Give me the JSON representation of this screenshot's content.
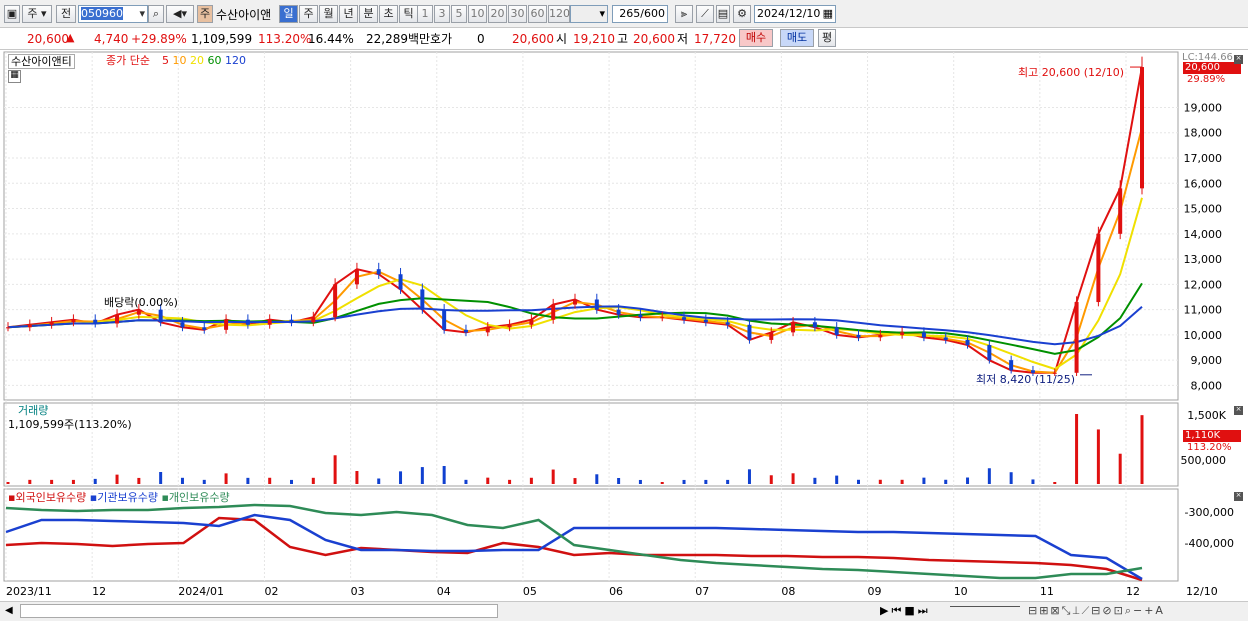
{
  "toolbar": {
    "market_sel": "주",
    "prev_label": "전",
    "code": "050960",
    "name_tag": "주",
    "stock_name": "수산아이앤",
    "periods": [
      "일",
      "주",
      "월",
      "년",
      "분",
      "초",
      "틱"
    ],
    "intervals": [
      "1",
      "3",
      "5",
      "10",
      "20",
      "30",
      "60",
      "120"
    ],
    "count": "265",
    "count_max": "/600",
    "date": "2024/12/10"
  },
  "quote": {
    "price": "20,600",
    "change": "4,740",
    "change_pct": "+29.89%",
    "volume": "1,109,599",
    "vol_ratio": "113.20%",
    "turnover": "16.44%",
    "amount": "22,289백만",
    "hoga_label": "호가",
    "hoga_value": "0",
    "hoga_price": "20,600",
    "open_label": "시",
    "open": "19,210",
    "high_label": "고",
    "high": "20,600",
    "low_label": "저",
    "low": "17,720",
    "buy_btn": "매수",
    "sell_btn": "매도",
    "eval_btn": "평"
  },
  "price_panel": {
    "legend_name": "수산아이앤티",
    "legend_ma": "종가 단순",
    "ma_periods": [
      "5",
      "10",
      "20",
      "60",
      "120"
    ],
    "ma_colors": [
      "#e01010",
      "#ff9a00",
      "#f0e000",
      "#009000",
      "#1a40d0"
    ],
    "corner_label": "LC:144.66",
    "high_annot": "최고 20,600 (12/10)",
    "low_annot": "최저 8,420 (11/25)",
    "dividend_annot": "배당락(0.00%)",
    "last_price_tag": "20,600",
    "last_pct_tag": "29.89%",
    "y_ticks": [
      "19,000",
      "18,000",
      "17,000",
      "16,000",
      "15,000",
      "14,000",
      "13,000",
      "12,000",
      "11,000",
      "10,000",
      "9,000",
      "8,000"
    ]
  },
  "volume_panel": {
    "title": "거래량",
    "info": "1,109,599주(113.20%)",
    "y_ticks": [
      "1,500K",
      "500,000"
    ],
    "last_tag": "1,110K",
    "last_pct": "113.20%"
  },
  "holding_panel": {
    "series": [
      "외국인보유수량",
      "기관보유수량",
      "개인보유수량"
    ],
    "colors": [
      "#d01010",
      "#1a40d0",
      "#2e8b57"
    ],
    "y_ticks": [
      "-300,000",
      "-400,000"
    ]
  },
  "x_axis": {
    "labels": [
      "2023/11",
      "12",
      "2024/01",
      "02",
      "03",
      "04",
      "05",
      "06",
      "07",
      "08",
      "09",
      "10",
      "11",
      "12",
      "12/10"
    ]
  },
  "chart_data": {
    "type": "candlestick",
    "period": "2023/11 - 2024/12/10",
    "price_range": [
      7700,
      20800
    ],
    "high": {
      "value": 20600,
      "date": "12/10"
    },
    "low": {
      "value": 8420,
      "date": "11/25"
    },
    "last": {
      "open": 19210,
      "high": 20600,
      "low": 17720,
      "close": 20600,
      "change_pct": 29.89
    },
    "approx_closes": [
      10300,
      10400,
      10500,
      10600,
      10450,
      10800,
      11000,
      10500,
      10300,
      10200,
      10600,
      10400,
      10600,
      10500,
      10700,
      12000,
      12600,
      12400,
      11800,
      11000,
      10200,
      10100,
      10300,
      10400,
      10600,
      11200,
      11400,
      11000,
      10800,
      10700,
      10700,
      10600,
      10500,
      10400,
      9800,
      10100,
      10500,
      10300,
      10000,
      9900,
      10000,
      10100,
      9900,
      9800,
      9600,
      9000,
      8600,
      8500,
      8500,
      11300,
      14000,
      15800,
      20600
    ]
  }
}
